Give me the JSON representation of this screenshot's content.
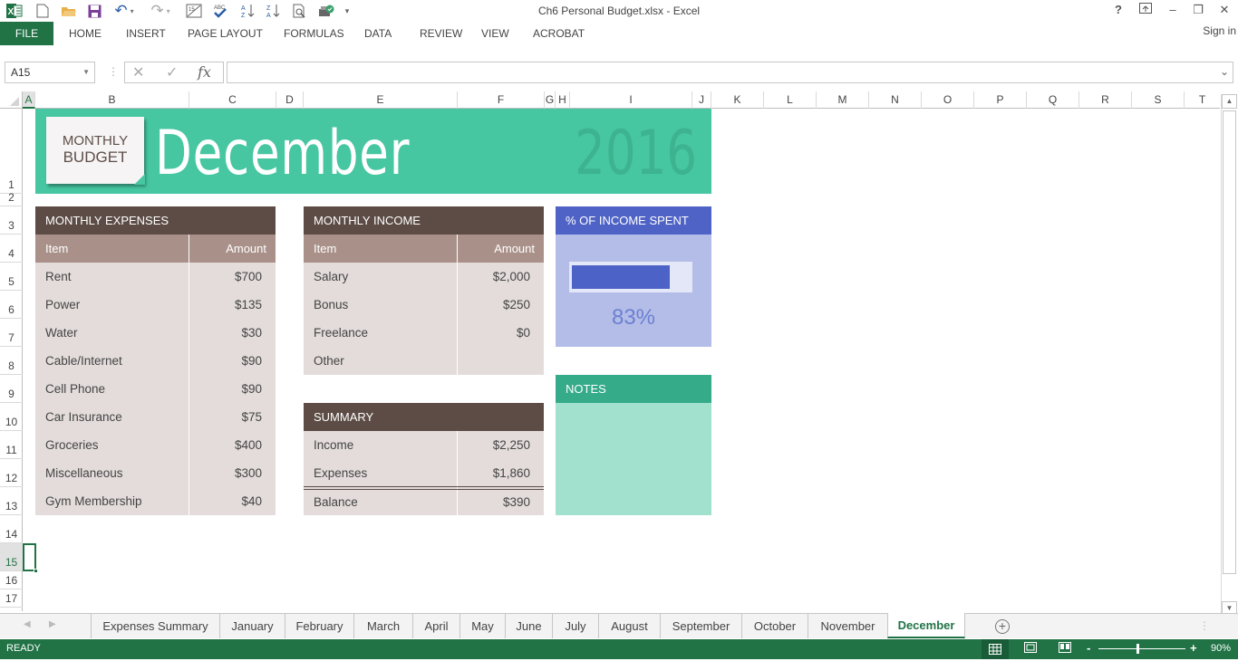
{
  "app": {
    "title": "Ch6 Personal Budget.xlsx - Excel",
    "quick_access": [
      "excel-logo",
      "new-file",
      "open-folder",
      "save",
      "undo",
      "redo",
      "spelling-date",
      "spell-check",
      "sort-ascending",
      "sort-descending",
      "print-preview",
      "publish",
      "customize"
    ],
    "window_controls": {
      "help": "?",
      "ribbon_display": "⊼",
      "minimize": "–",
      "restore": "❐",
      "close": "✕"
    }
  },
  "ribbon": {
    "file": "FILE",
    "tabs": [
      "HOME",
      "INSERT",
      "PAGE LAYOUT",
      "FORMULAS",
      "DATA",
      "REVIEW",
      "VIEW",
      "ACROBAT"
    ],
    "sign_in": "Sign in"
  },
  "formula_bar": {
    "name_box": "A15",
    "cancel": "✕",
    "enter": "✓",
    "fx": "fx",
    "value": ""
  },
  "columns": [
    "A",
    "B",
    "C",
    "D",
    "E",
    "F",
    "G",
    "H",
    "I",
    "J",
    "K",
    "L",
    "M",
    "N",
    "O",
    "P",
    "Q",
    "R",
    "S",
    "T"
  ],
  "selected_column": "A",
  "rows": [
    "1",
    "2",
    "3",
    "4",
    "5",
    "6",
    "7",
    "8",
    "9",
    "10",
    "11",
    "12",
    "13",
    "14",
    "15",
    "16",
    "17"
  ],
  "selected_row": "15",
  "banner": {
    "stamp_line1": "MONTHLY",
    "stamp_line2": "BUDGET",
    "month": "December",
    "year": "2016"
  },
  "expenses": {
    "title": "MONTHLY EXPENSES",
    "col_item": "Item",
    "col_amount": "Amount",
    "rows": [
      {
        "item": "Rent",
        "amount": "$700"
      },
      {
        "item": "Power",
        "amount": "$135"
      },
      {
        "item": "Water",
        "amount": "$30"
      },
      {
        "item": "Cable/Internet",
        "amount": "$90"
      },
      {
        "item": "Cell Phone",
        "amount": "$90"
      },
      {
        "item": "Car Insurance",
        "amount": "$75"
      },
      {
        "item": "Groceries",
        "amount": "$400"
      },
      {
        "item": "Miscellaneous",
        "amount": "$300"
      },
      {
        "item": "Gym Membership",
        "amount": "$40"
      }
    ]
  },
  "income": {
    "title": "MONTHLY INCOME",
    "col_item": "Item",
    "col_amount": "Amount",
    "rows": [
      {
        "item": "Salary",
        "amount": "$2,000"
      },
      {
        "item": "Bonus",
        "amount": "$250"
      },
      {
        "item": "Freelance",
        "amount": "$0"
      },
      {
        "item": "Other",
        "amount": ""
      }
    ]
  },
  "summary": {
    "title": "SUMMARY",
    "rows": [
      {
        "item": "Income",
        "amount": "$2,250"
      },
      {
        "item": "Expenses",
        "amount": "$1,860"
      },
      {
        "item": "Balance",
        "amount": "$390"
      }
    ]
  },
  "percent_spent": {
    "title": "% OF INCOME SPENT",
    "value": 0.83,
    "label": "83%"
  },
  "notes": {
    "title": "NOTES",
    "content": ""
  },
  "sheet_tabs": [
    "Expenses Summary",
    "January",
    "February",
    "March",
    "April",
    "May",
    "June",
    "July",
    "August",
    "September",
    "October",
    "November",
    "December"
  ],
  "active_sheet": "December",
  "status": {
    "mode": "READY",
    "zoom": "90%",
    "zoom_value": 90
  },
  "colors": {
    "excel_green": "#217346",
    "banner_teal": "#46c6a1",
    "header_brown": "#5c4c45",
    "subheader_brown": "#a99189",
    "body_beige": "#e3dcdb",
    "percent_blue": "#4f63c6",
    "notes_green": "#35ab89"
  }
}
